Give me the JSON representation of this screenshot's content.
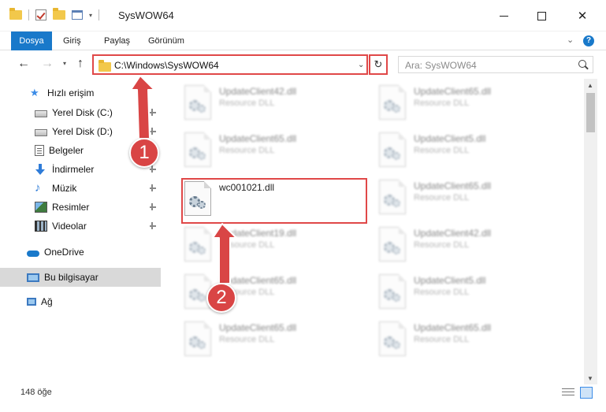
{
  "window": {
    "title": "SysWOW64",
    "minimize_glyph": "—",
    "close_glyph": "✕"
  },
  "ribbon": {
    "tabs": [
      "Dosya",
      "Giriş",
      "Paylaş",
      "Görünüm"
    ],
    "help": "?"
  },
  "address": {
    "path": "C:\\Windows\\SysWOW64",
    "search_placeholder": "Ara: SysWOW64"
  },
  "sidebar": {
    "quick_access": "Hızlı erişim",
    "items": [
      {
        "label": "Yerel Disk (C:)",
        "icon": "drive-icon",
        "pinned": true
      },
      {
        "label": "Yerel Disk (D:)",
        "icon": "drive-icon",
        "pinned": true
      },
      {
        "label": "Belgeler",
        "icon": "documents-icon",
        "pinned": true
      },
      {
        "label": "İndirmeler",
        "icon": "download-icon",
        "pinned": true
      },
      {
        "label": "Müzik",
        "icon": "music-icon",
        "pinned": true
      },
      {
        "label": "Resimler",
        "icon": "pictures-icon",
        "pinned": true
      },
      {
        "label": "Videolar",
        "icon": "videos-icon",
        "pinned": true
      }
    ],
    "onedrive": "OneDrive",
    "this_pc": "Bu bilgisayar",
    "network": "Ağ"
  },
  "files": {
    "col1": [
      {
        "name": "UpdateClient42.dll",
        "type": "Resource DLL"
      },
      {
        "name": "UpdateClient65.dll",
        "type": "Resource DLL"
      },
      {
        "name": "wc001021.dll",
        "type": ""
      },
      {
        "name": "UpdateClient19.dll",
        "type": "Resource DLL"
      },
      {
        "name": "UpdateClient65.dll",
        "type": "Resource DLL"
      },
      {
        "name": "UpdateClient65.dll",
        "type": "Resource DLL"
      }
    ],
    "col2": [
      {
        "name": "UpdateClient65.dll",
        "type": "Resource DLL"
      },
      {
        "name": "UpdateClient5.dll",
        "type": "Resource DLL"
      },
      {
        "name": "UpdateClient65.dll",
        "type": "Resource DLL"
      },
      {
        "name": "UpdateClient42.dll",
        "type": "Resource DLL"
      },
      {
        "name": "UpdateClient5.dll",
        "type": "Resource DLL"
      },
      {
        "name": "UpdateClient65.dll",
        "type": "Resource DLL"
      }
    ]
  },
  "status": {
    "item_count": "148 öğe"
  },
  "annotations": {
    "step1": "1",
    "step2": "2",
    "color": "#d94545"
  }
}
